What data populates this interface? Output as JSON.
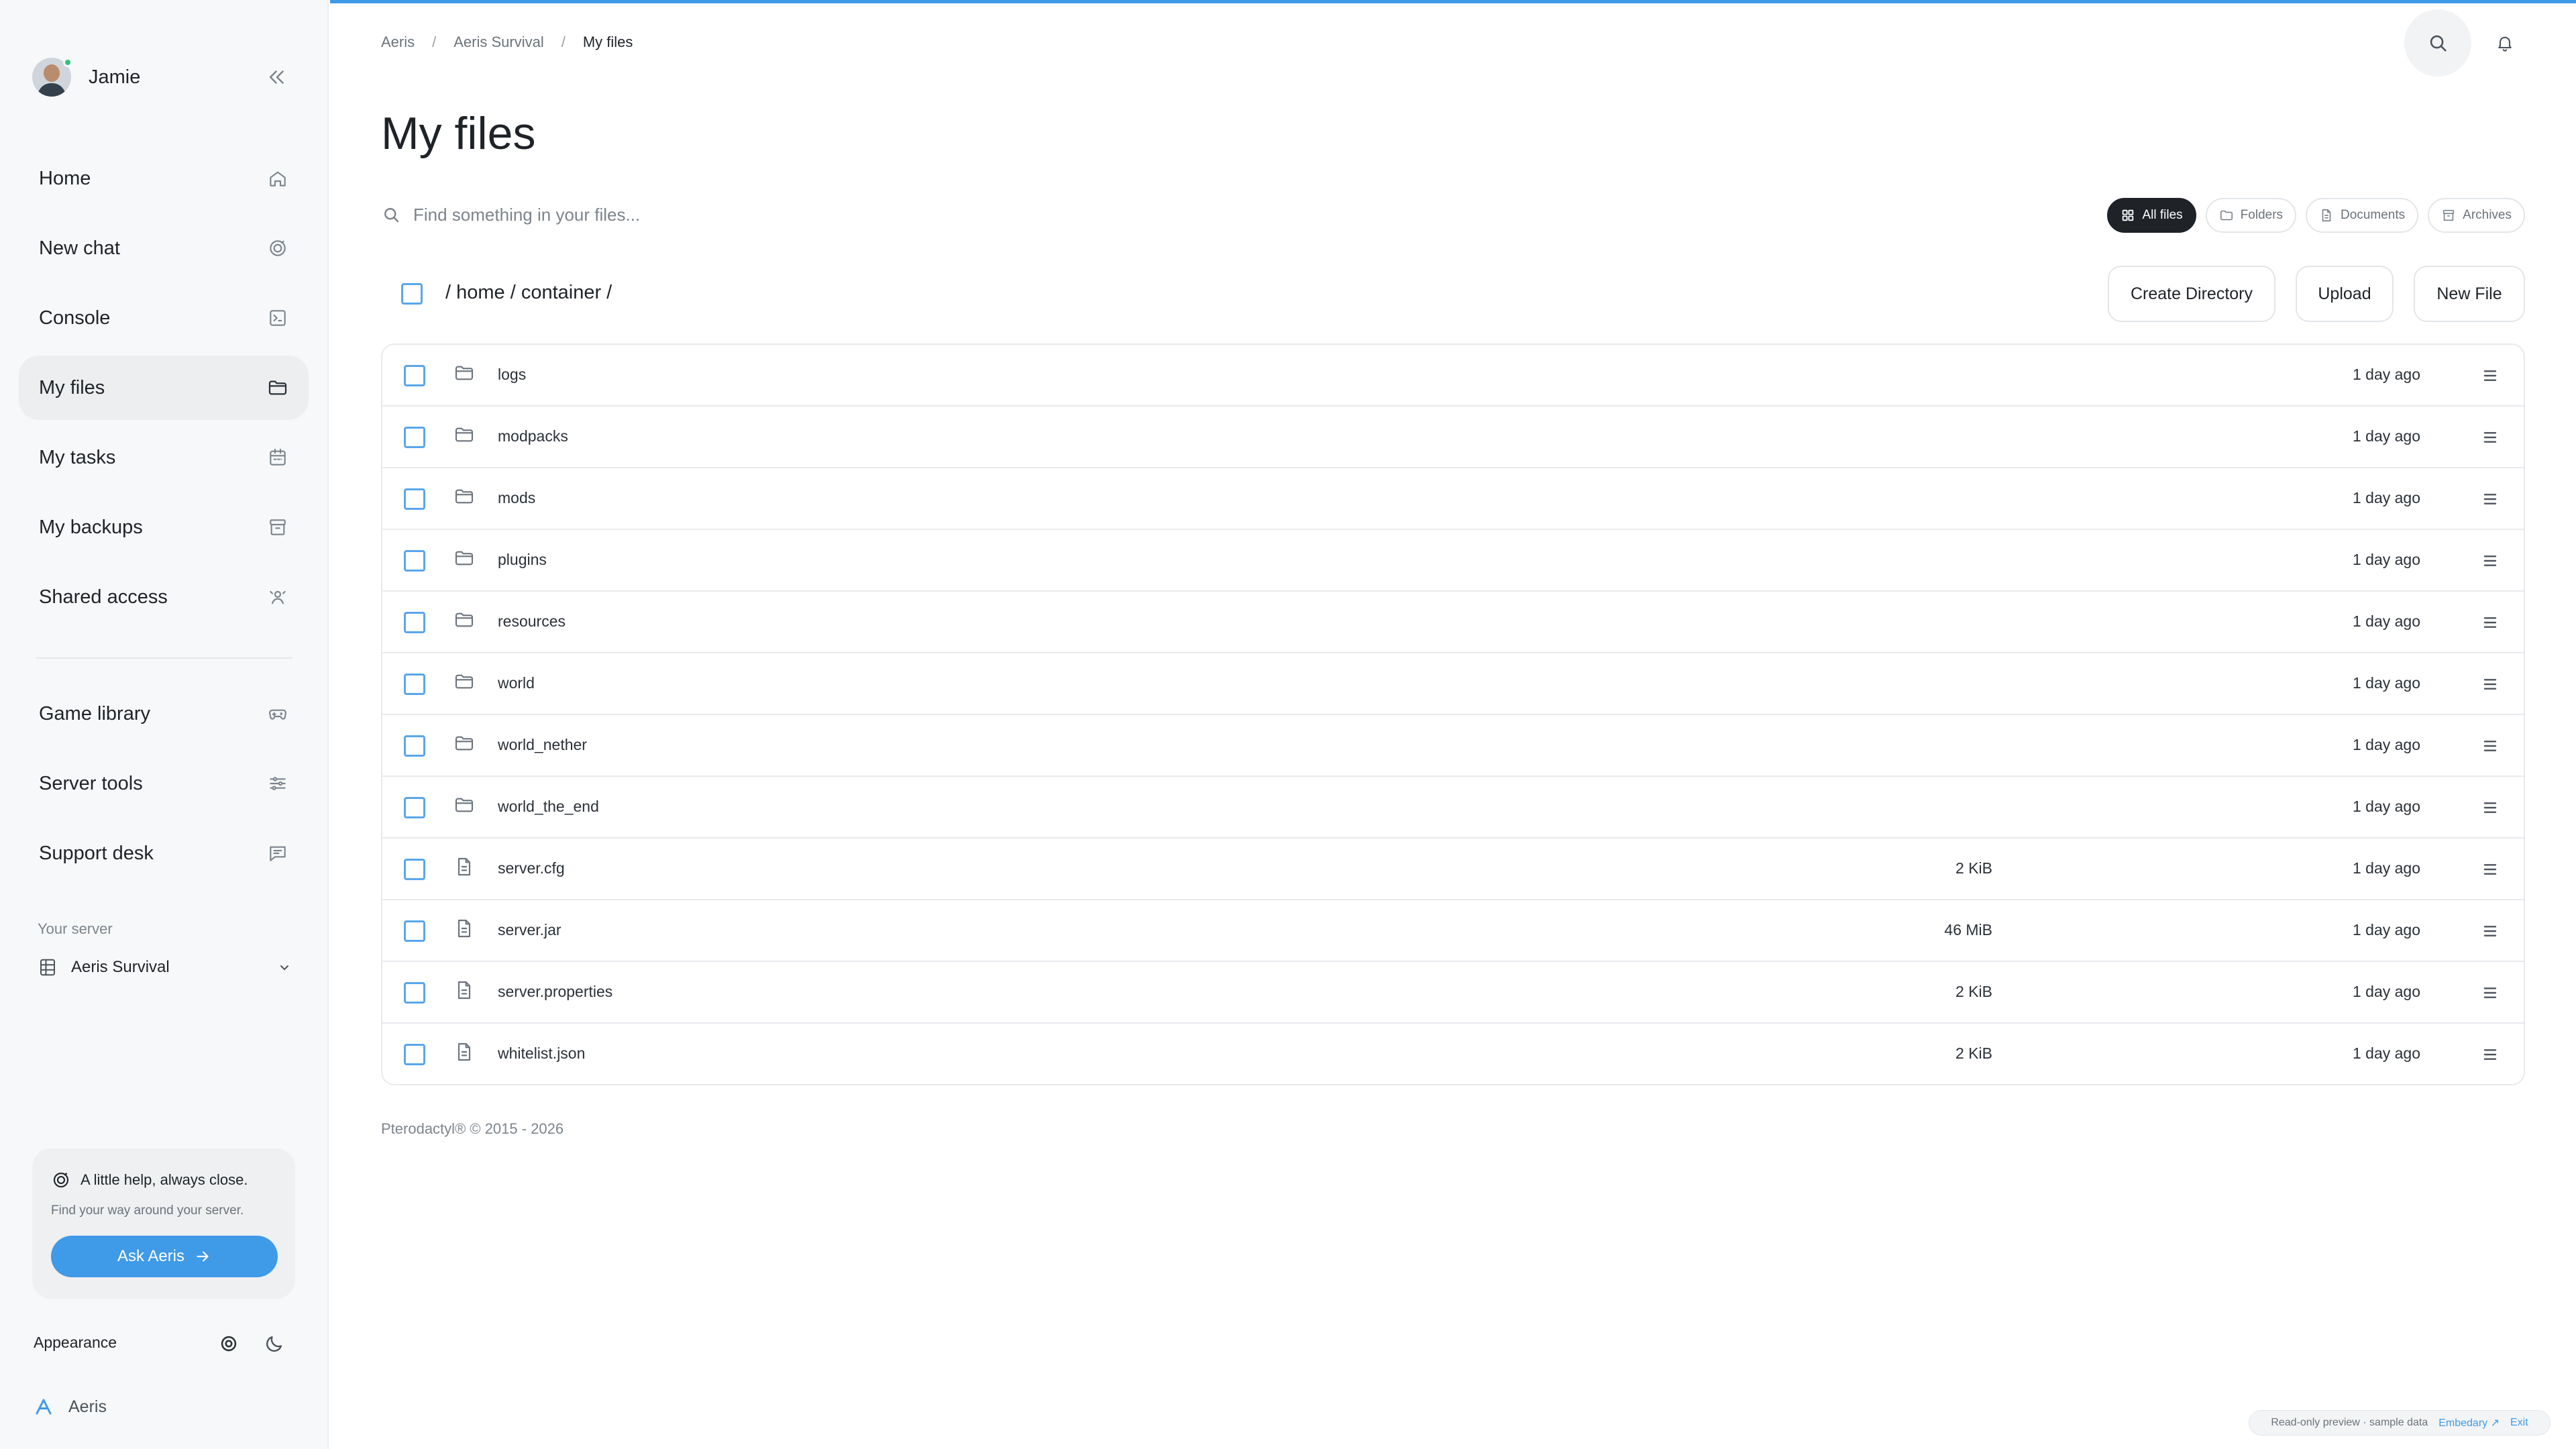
{
  "sidebar": {
    "user_name": "Jamie",
    "nav": [
      {
        "label": "Home",
        "icon": "home-icon"
      },
      {
        "label": "New chat",
        "icon": "chat-icon"
      },
      {
        "label": "Console",
        "icon": "terminal-icon"
      },
      {
        "label": "My files",
        "icon": "folder-icon",
        "active": true
      },
      {
        "label": "My tasks",
        "icon": "calendar-icon"
      },
      {
        "label": "My backups",
        "icon": "archive-icon"
      },
      {
        "label": "Shared access",
        "icon": "people-icon"
      }
    ],
    "nav2": [
      {
        "label": "Game library",
        "icon": "gamepad-icon"
      },
      {
        "label": "Server tools",
        "icon": "sliders-icon"
      },
      {
        "label": "Support desk",
        "icon": "message-icon"
      }
    ],
    "server_caption": "Your server",
    "server_name": "Aeris Survival",
    "help": {
      "title": "A little help, always close.",
      "subtitle": "Find your way around your server.",
      "button": "Ask Aeris"
    },
    "appearance_label": "Appearance",
    "brand": "Aeris"
  },
  "breadcrumb": [
    "Aeris",
    "Aeris Survival",
    "My files"
  ],
  "page_title": "My files",
  "search": {
    "placeholder": "Find something in your files..."
  },
  "filters": [
    {
      "label": "All files",
      "icon": "grid-icon",
      "active": true
    },
    {
      "label": "Folders",
      "icon": "folder-icon"
    },
    {
      "label": "Documents",
      "icon": "document-icon"
    },
    {
      "label": "Archives",
      "icon": "archive-icon"
    }
  ],
  "path": "/ home / container /",
  "actions": {
    "create_dir": "Create Directory",
    "upload": "Upload",
    "new_file": "New File"
  },
  "files": [
    {
      "name": "logs",
      "type": "folder",
      "size": "",
      "modified": "1 day ago"
    },
    {
      "name": "modpacks",
      "type": "folder",
      "size": "",
      "modified": "1 day ago"
    },
    {
      "name": "mods",
      "type": "folder",
      "size": "",
      "modified": "1 day ago"
    },
    {
      "name": "plugins",
      "type": "folder",
      "size": "",
      "modified": "1 day ago"
    },
    {
      "name": "resources",
      "type": "folder",
      "size": "",
      "modified": "1 day ago"
    },
    {
      "name": "world",
      "type": "folder",
      "size": "",
      "modified": "1 day ago"
    },
    {
      "name": "world_nether",
      "type": "folder",
      "size": "",
      "modified": "1 day ago"
    },
    {
      "name": "world_the_end",
      "type": "folder",
      "size": "",
      "modified": "1 day ago"
    },
    {
      "name": "server.cfg",
      "type": "file",
      "size": "2 KiB",
      "modified": "1 day ago"
    },
    {
      "name": "server.jar",
      "type": "file",
      "size": "46 MiB",
      "modified": "1 day ago"
    },
    {
      "name": "server.properties",
      "type": "file",
      "size": "2 KiB",
      "modified": "1 day ago"
    },
    {
      "name": "whitelist.json",
      "type": "file",
      "size": "2 KiB",
      "modified": "1 day ago"
    }
  ],
  "footer": "Pterodactyl® © 2015 - 2026",
  "preview": {
    "text": "Read-only preview · sample data",
    "link": "Embedary ↗",
    "exit": "Exit"
  },
  "colors": {
    "accent": "#3f9ae8",
    "dark_chip": "#1f2328",
    "sidebar_bg": "#f7f8f9"
  }
}
